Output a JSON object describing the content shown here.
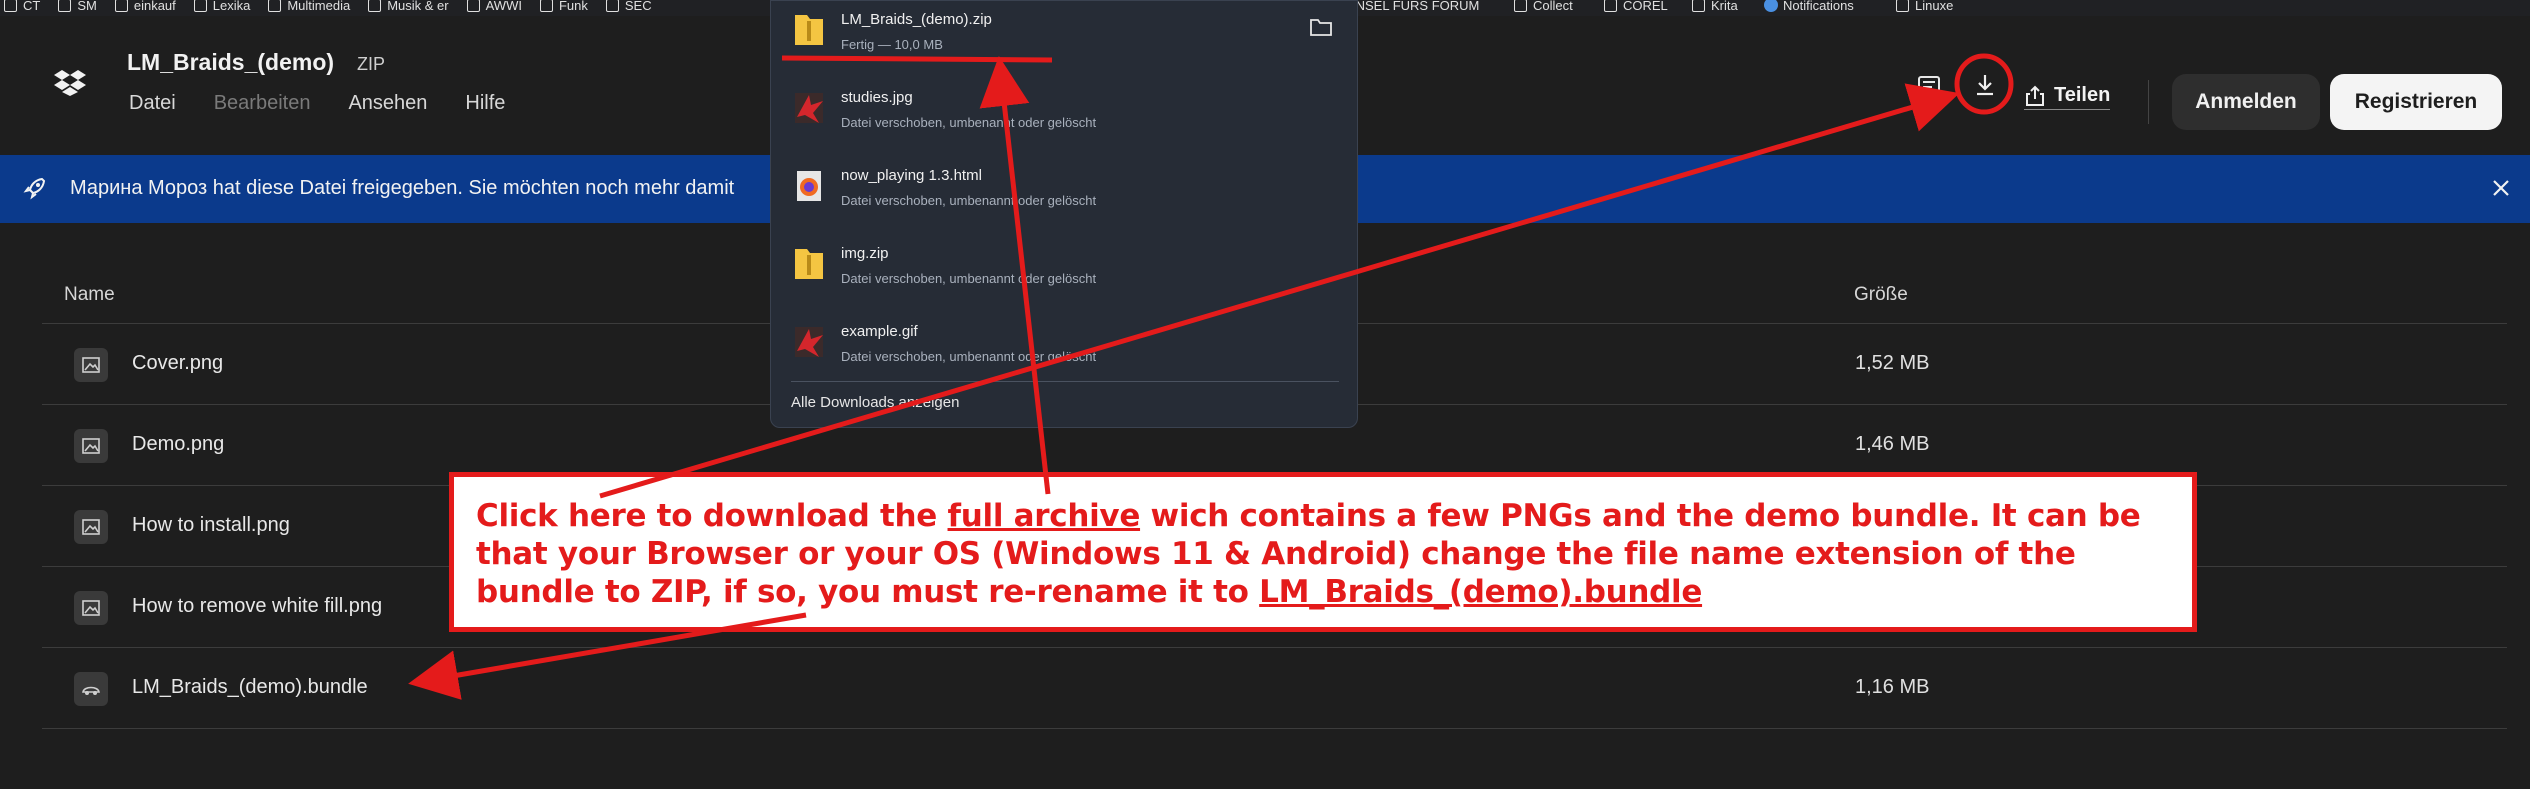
{
  "bookmarks": [
    {
      "label": "CT",
      "icon": "folder-icon"
    },
    {
      "label": "SM",
      "icon": "folder-icon"
    },
    {
      "label": "einkauf",
      "icon": "folder-icon"
    },
    {
      "label": "Lexika",
      "icon": "folder-icon"
    },
    {
      "label": "Multimedia",
      "icon": "folder-icon"
    },
    {
      "label": "Musik & er",
      "icon": "folder-icon"
    },
    {
      "label": "AWWI",
      "icon": "folder-icon"
    },
    {
      "label": "Funk",
      "icon": "folder-icon"
    },
    {
      "label": "SEC",
      "icon": "folder-icon"
    },
    {
      "label": "INSEL FURS FORUM",
      "icon": "folder-icon"
    },
    {
      "label": "Collect",
      "icon": "folder-icon"
    },
    {
      "label": "COREL",
      "icon": "folder-icon"
    },
    {
      "label": "Krita",
      "icon": "folder-icon"
    },
    {
      "label": "Notifications",
      "icon": "globe-icon"
    },
    {
      "label": "Linuxe",
      "icon": "folder-icon"
    }
  ],
  "header": {
    "title": "LM_Braids_(demo)",
    "type": "ZIP",
    "menu": [
      "Datei",
      "Bearbeiten",
      "Ansehen",
      "Hilfe"
    ],
    "share_label": "Teilen",
    "login_label": "Anmelden",
    "register_label": "Registrieren"
  },
  "banner": {
    "text": "Марина Мороз hat diese Datei freigegeben. Sie möchten noch mehr damit"
  },
  "table": {
    "col_name": "Name",
    "col_size": "Größe",
    "rows": [
      {
        "name": "Cover.png",
        "size": "1,52 MB",
        "icon": "image-file-icon"
      },
      {
        "name": "Demo.png",
        "size": "1,46 MB",
        "icon": "image-file-icon"
      },
      {
        "name": "How to install.png",
        "size": "",
        "icon": "image-file-icon"
      },
      {
        "name": "How to remove white fill.png",
        "size": "",
        "icon": "image-file-icon"
      },
      {
        "name": "LM_Braids_(demo).bundle",
        "size": "1,16 MB",
        "icon": "bundle-file-icon"
      }
    ]
  },
  "downloads": {
    "items": [
      {
        "name": "LM_Braids_(demo).zip",
        "status": "Fertig — 10,0 MB",
        "icon": "zip-folder-icon"
      },
      {
        "name": "studies.jpg",
        "status": "Datei verschoben, umbenannt oder gelöscht",
        "icon": "krita-file-icon"
      },
      {
        "name": "now_playing 1.3.html",
        "status": "Datei verschoben, umbenannt oder gelöscht",
        "icon": "firefox-icon"
      },
      {
        "name": "img.zip",
        "status": "Datei verschoben, umbenannt oder gelöscht",
        "icon": "zip-folder-icon"
      },
      {
        "name": "example.gif",
        "status": "Datei verschoben, umbenannt oder gelöscht",
        "icon": "krita-file-icon"
      }
    ],
    "show_all_label": "Alle Downloads anzeigen"
  },
  "annotation": {
    "part1": "Click here to download the ",
    "link1": "full archive",
    "part2": " wich contains a few PNGs and the demo bundle. It can be that your Browser or your OS (Windows 11 & Android) change the file name extension of the bundle to ZIP, if so, you must re-rename it to ",
    "link2": "LM_Braids_(demo).bundle"
  },
  "colors": {
    "annotation_red": "#e41b1b",
    "banner_blue": "#0b3a8c",
    "page_bg": "#1e1e1e"
  }
}
